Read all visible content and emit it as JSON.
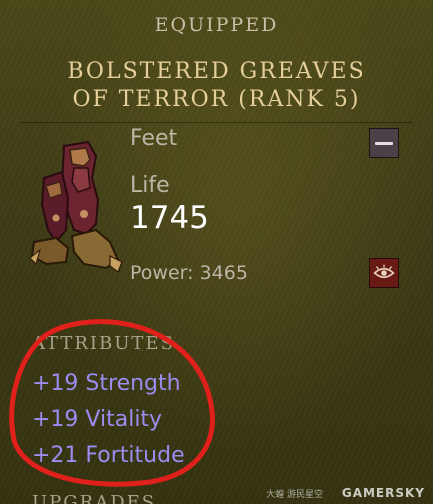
{
  "tooltip": {
    "header": "EQUIPPED",
    "item_name_line1": "Bolstered Greaves",
    "item_name_line2": "of Terror (Rank 5)",
    "slot": "Feet",
    "stat_label": "Life",
    "stat_value": "1745",
    "power": "Power: 3465",
    "attributes_header": "ATTRIBUTES",
    "attributes": [
      "+19 Strength",
      "+19 Vitality",
      "+21 Fortitude"
    ],
    "upgrades_header": "UPGRADES"
  },
  "watermark": {
    "brand": "GAMERSKY",
    "prefix": "大蝗 游民星空"
  },
  "colors": {
    "item_name": "#e6cf9a",
    "attribute": "#9b8cf0",
    "annotation_circle": "#e0201a"
  },
  "icons": {
    "slot": "slot-type-icon",
    "action": "eye-icon"
  }
}
